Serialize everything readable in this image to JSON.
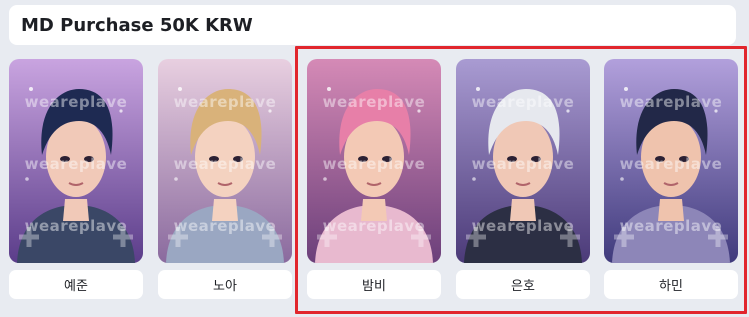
{
  "header": {
    "title": "MD Purchase 50K KRW"
  },
  "watermark": "weareplave",
  "selection_color": "#e1262d",
  "cards": [
    {
      "name": "예준",
      "palette": {
        "bg1": "#5b3d8a",
        "bg2": "#c9a4e0",
        "hair": "#1e2a52",
        "skin": "#f1c9b8",
        "shirt": "#3a4766"
      }
    },
    {
      "name": "노아",
      "palette": {
        "bg1": "#8a6a9e",
        "bg2": "#e8cfe0",
        "hair": "#d9b27a",
        "skin": "#f4d2c0",
        "shirt": "#9aa7c2"
      }
    },
    {
      "name": "밤비",
      "palette": {
        "bg1": "#6b3f7a",
        "bg2": "#d58ab6",
        "hair": "#e77fa8",
        "skin": "#f3c9b5",
        "shirt": "#e8b9cf"
      }
    },
    {
      "name": "은호",
      "palette": {
        "bg1": "#4b3a78",
        "bg2": "#a99bd2",
        "hair": "#e6e8ee",
        "skin": "#f0c8b6",
        "shirt": "#2c2f44"
      }
    },
    {
      "name": "하민",
      "palette": {
        "bg1": "#3f3a7c",
        "bg2": "#b2a0dc",
        "hair": "#222848",
        "skin": "#efc3ad",
        "shirt": "#8d86b8"
      }
    }
  ]
}
